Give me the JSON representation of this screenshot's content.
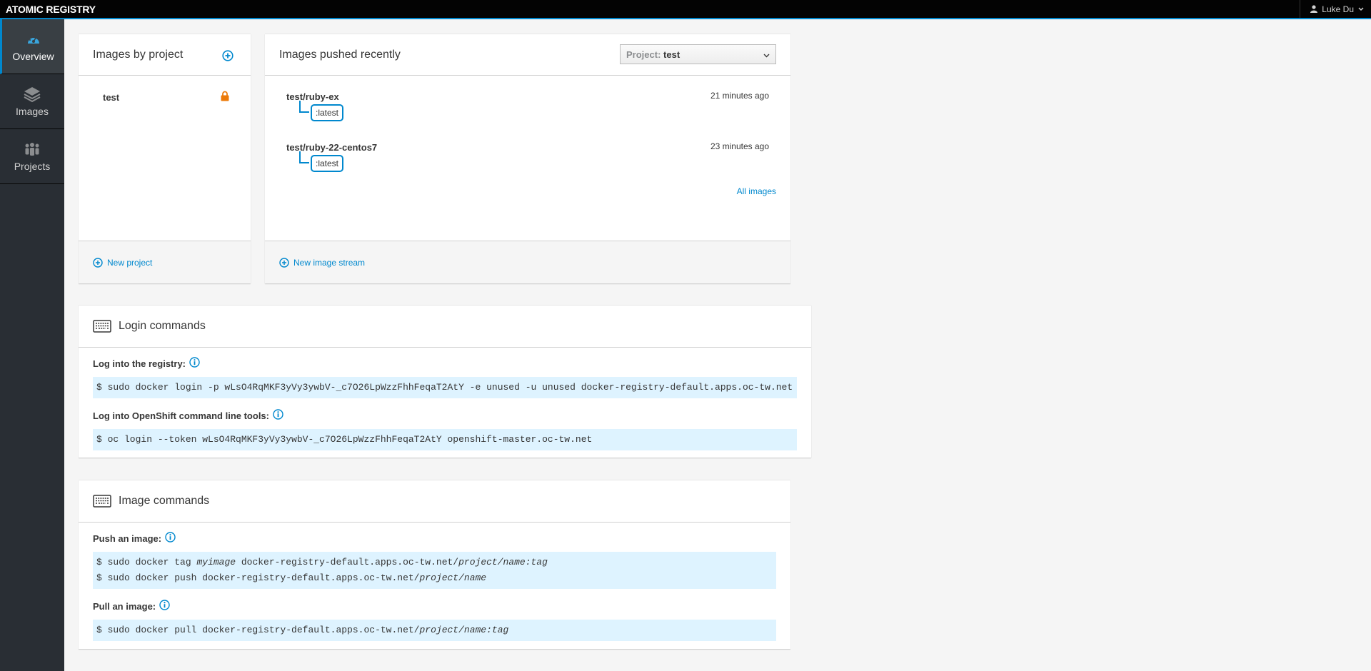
{
  "app": {
    "brand": "ATOMIC REGISTRY",
    "user_name": "Luke Du"
  },
  "sidebar": {
    "items": [
      {
        "label": "Overview",
        "icon": "dashboard-icon",
        "active": true
      },
      {
        "label": "Images",
        "icon": "layers-icon",
        "active": false
      },
      {
        "label": "Projects",
        "icon": "users-icon",
        "active": false
      }
    ]
  },
  "projects_card": {
    "title": "Images by project",
    "projects": [
      {
        "name": "test",
        "locked": true
      }
    ],
    "new_project": "New project"
  },
  "recent_card": {
    "title": "Images pushed recently",
    "project_select": {
      "label": "Project:",
      "value": "test"
    },
    "images": [
      {
        "name": "test/ruby-ex",
        "tag": ":latest",
        "time": "21 minutes ago"
      },
      {
        "name": "test/ruby-22-centos7",
        "tag": ":latest",
        "time": "23 minutes ago"
      }
    ],
    "all_images": "All images",
    "new_image_stream": "New image stream"
  },
  "login_card": {
    "title": "Login commands",
    "registry_label": "Log into the registry:",
    "registry_cmd": "$ sudo docker login -p wLsO4RqMKF3yVy3ywbV-_c7O26LpWzzFhhFeqaT2AtY -e unused -u unused docker-registry-default.apps.oc-tw.net",
    "oc_label": "Log into OpenShift command line tools:",
    "oc_cmd": "$ oc login --token wLsO4RqMKF3yVy3ywbV-_c7O26LpWzzFhhFeqaT2AtY openshift-master.oc-tw.net"
  },
  "image_card": {
    "title": "Image commands",
    "push_label": "Push an image:",
    "push_tag": {
      "prefix": "$ sudo docker tag ",
      "image": "myimage",
      "registry": " docker-registry-default.apps.oc-tw.net/",
      "path": "project/name:tag"
    },
    "push_push": {
      "prefix": "$ sudo docker push docker-registry-default.apps.oc-tw.net/",
      "path": "project/name"
    },
    "pull_label": "Pull an image:",
    "pull_cmd": {
      "prefix": "$ sudo docker pull docker-registry-default.apps.oc-tw.net/",
      "path": "project/name:tag"
    }
  },
  "colors": {
    "accent": "#0088ce",
    "lock": "#ec7a08",
    "command_bg": "#def3ff"
  }
}
